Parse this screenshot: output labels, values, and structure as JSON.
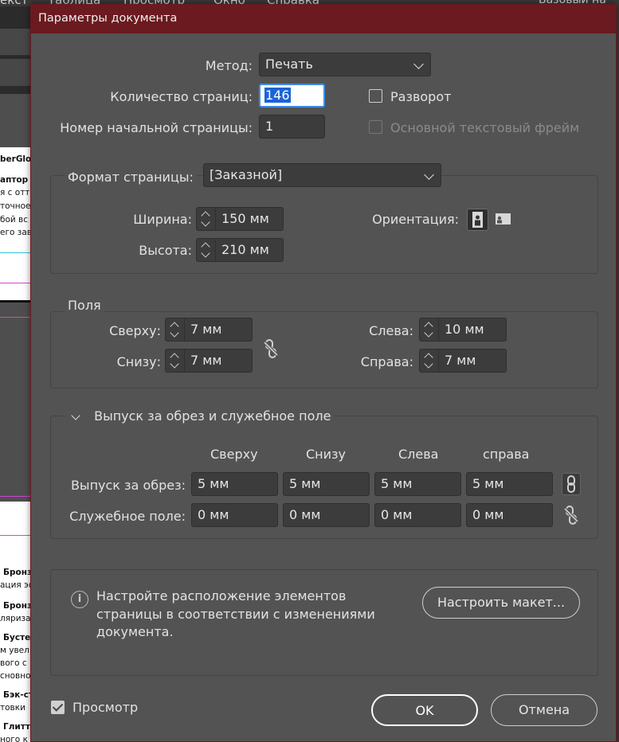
{
  "background": {
    "menu_items": [
      "екст",
      "Таблица",
      "Просмотр",
      "Окно",
      "Справка"
    ],
    "right_label": "Базовый на",
    "page_text": [
      "berGlov",
      "аптор",
      "я с отте",
      "точное",
      "бой вс",
      "его зав",
      "Бронз",
      "ация эф",
      "Бронз",
      "ляриза",
      "Бусте",
      "м увел",
      "вого с",
      "сновно",
      "Бэк-ст",
      "товки",
      "Глитт",
      "ного к"
    ]
  },
  "dialog": {
    "title": "Параметры документа",
    "method_label": "Метод:",
    "method_value": "Печать",
    "pages_label": "Количество страниц:",
    "pages_value": "146",
    "facing_label": "Разворот",
    "start_page_label": "Номер начальной страницы:",
    "start_page_value": "1",
    "primary_frame_label": "Основной текстовый фрейм",
    "page_size_label": "Формат страницы:",
    "page_size_value": "[Заказной]",
    "width_label": "Ширина:",
    "width_value": "150 мм",
    "height_label": "Высота:",
    "height_value": "210 мм",
    "orientation_label": "Ориентация:",
    "margins_title": "Поля",
    "top_label": "Сверху:",
    "top_value": "7 мм",
    "bottom_label": "Снизу:",
    "bottom_value": "7 мм",
    "left_label": "Слева:",
    "left_value": "10 мм",
    "right_label": "Справа:",
    "right_value": "7 мм",
    "bleed_section_title": "Выпуск за обрез и служебное поле",
    "col_top": "Сверху",
    "col_bottom": "Снизу",
    "col_left": "Слева",
    "col_right": "справа",
    "bleed_label": "Выпуск за обрез:",
    "bleed_values": [
      "5 мм",
      "5 мм",
      "5 мм",
      "5 мм"
    ],
    "slug_label": "Служебное поле:",
    "slug_values": [
      "0 мм",
      "0 мм",
      "0 мм",
      "0 мм"
    ],
    "info_text_1": "Настройте расположение элементов",
    "info_text_2": "страницы в соответствии с изменениями",
    "info_text_3": "документа.",
    "adjust_button": "Настроить макет...",
    "preview_label": "Просмотр",
    "ok_button": "OK",
    "cancel_button": "Отмена"
  }
}
